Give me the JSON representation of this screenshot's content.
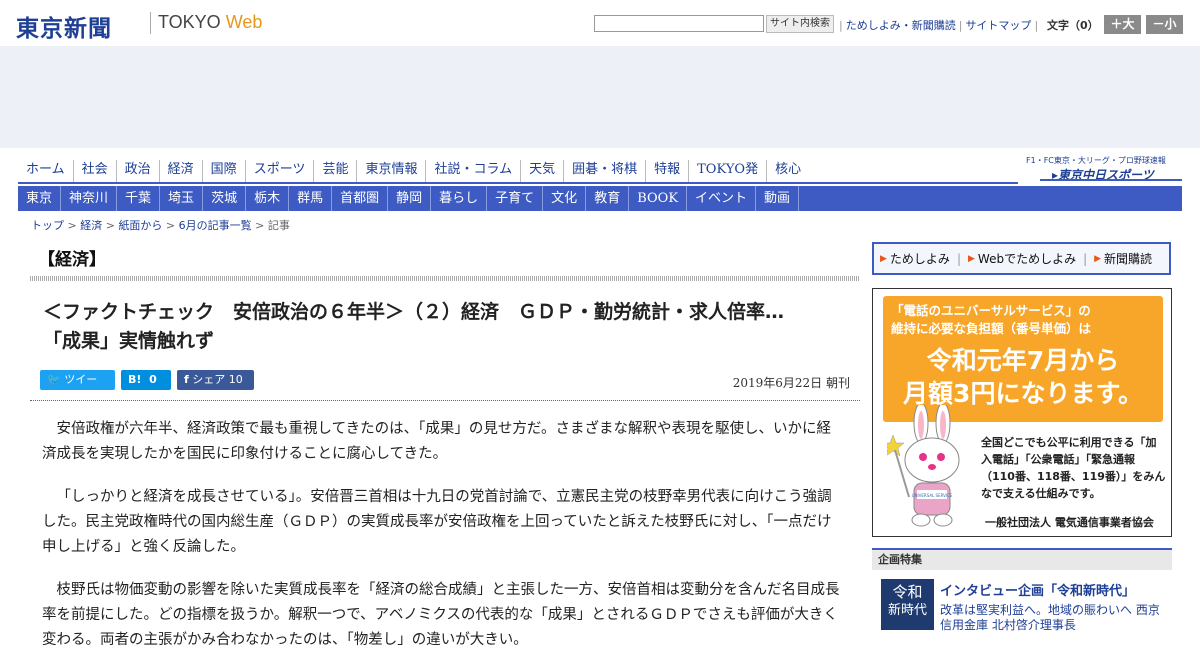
{
  "header": {
    "logo": "東京新聞",
    "logo_sub_a": "TOKYO ",
    "logo_sub_b": "Web",
    "search_button": "サイト内検索",
    "links": [
      "ためしよみ・新聞購読",
      "サイトマップ"
    ],
    "font_size_label": "文字（0）",
    "font_larger": "＋大",
    "font_smaller": "－小"
  },
  "nav_main": [
    "ホーム",
    "社会",
    "政治",
    "経済",
    "国際",
    "スポーツ",
    "芸能",
    "東京情報",
    "社説・コラム",
    "天気",
    "囲碁・将棋",
    "特報",
    "TOKYO発",
    "核心"
  ],
  "chunichi": {
    "line1": "F1・FC東京・大リーグ・プロ野球速報",
    "line2": "▸東京中日スポーツ"
  },
  "nav_sub": [
    "東京",
    "神奈川",
    "千葉",
    "埼玉",
    "茨城",
    "栃木",
    "群馬",
    "首都圏",
    "静岡",
    "暮らし",
    "子育て",
    "文化",
    "教育",
    "BOOK",
    "イベント",
    "動画"
  ],
  "breadcrumb": [
    "トップ",
    "経済",
    "紙面から",
    "6月の記事一覧",
    "記事"
  ],
  "section": "【経済】",
  "article": {
    "headline_1": "＜ファクトチェック　安倍政治の６年半＞（２）経済　ＧＤＰ・勤労統計・求人倍率…",
    "headline_2": "「成果」実情触れず",
    "date": "2019年6月22日 朝刊",
    "paragraphs": [
      "安倍政権が六年半、経済政策で最も重視してきたのは、「成果」の見せ方だ。さまざまな解釈や表現を駆使し、いかに経済成長を実現したかを国民に印象付けることに腐心してきた。",
      "「しっかりと経済を成長させている」。安倍晋三首相は十九日の党首討論で、立憲民主党の枝野幸男代表に向けこう強調した。民主党政権時代の国内総生産（ＧＤＰ）の実質成長率が安倍政権を上回っていたと訴えた枝野氏に対し、「一点だけ申し上げる」と強く反論した。",
      "枝野氏は物価変動の影響を除いた実質成長率を「経済の総合成績」と主張した一方、安倍首相は変動分を含んだ名目成長率を前提にした。どの指標を扱うか。解釈一つで、アベノミクスの代表的な「成果」とされるＧＤＰでさえも評価が大きく変わる。両者の主張がかみ合わなかったのは、「物差し」の違いが大きい。"
    ]
  },
  "share": {
    "tweet": "ツイート",
    "hatena_mark": "B!",
    "hatena_count": "0",
    "facebook_mark": "f",
    "facebook": "シェア",
    "facebook_count": "10"
  },
  "subscribe": [
    "ためしよみ",
    "Webでためしよみ",
    "新聞購読"
  ],
  "ad": {
    "top_line1": "「電話のユニバーサルサービス」の",
    "top_line2": "維持に必要な負担額（番号単価）は",
    "big_line1": "令和元年7月から",
    "big_line2": "月額3円になります。",
    "text": "全国どこでも公平に利用できる「加入電話」「公衆電話」「緊急通報（110番、118番、119番）」をみんなで支える仕組みです。",
    "footer": "一般社団法人 電気通信事業者協会",
    "mascot_label": "UNIVERSAL SERVICE"
  },
  "feature": {
    "header": "企画特集",
    "thumb_1": "令和",
    "thumb_2": "新時代",
    "title": "インタビュー企画「令和新時代」",
    "desc": "改革は堅実利益へ。地域の賑わいへ 西京信用金庫 北村啓介理事長"
  },
  "colors": {
    "brand_blue": "#1e3f96",
    "nav_blue": "#3d5bc2",
    "twitter": "#1da1f2",
    "facebook": "#3b5998",
    "ad_orange": "#f7a62a"
  }
}
